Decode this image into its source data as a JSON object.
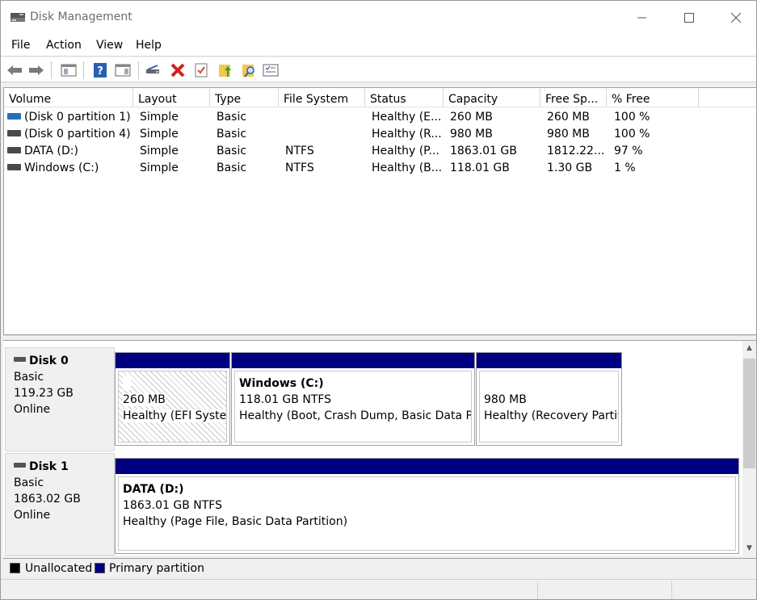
{
  "window": {
    "title": "Disk Management",
    "minimize_icon": "minimize-icon",
    "maximize_icon": "maximize-icon",
    "close_icon": "close-icon"
  },
  "menu": [
    "File",
    "Action",
    "View",
    "Help"
  ],
  "toolbar": [
    "back-arrow-icon",
    "forward-arrow-icon",
    "console-tree-icon",
    "help-icon",
    "action-pane-icon",
    "connect-drive-icon",
    "delete-icon",
    "check-icon",
    "folder-up-icon",
    "folder-search-icon",
    "properties-icon"
  ],
  "volume_list": {
    "columns": [
      "Volume",
      "Layout",
      "Type",
      "File System",
      "Status",
      "Capacity",
      "Free Sp...",
      "% Free"
    ],
    "rows": [
      {
        "volume": "(Disk 0 partition 1)",
        "layout": "Simple",
        "type": "Basic",
        "fs": "",
        "status": "Healthy (E...",
        "capacity": "260 MB",
        "free": "260 MB",
        "pct": "100 %",
        "icon_color": "#2a6ebb"
      },
      {
        "volume": "(Disk 0 partition 4)",
        "layout": "Simple",
        "type": "Basic",
        "fs": "",
        "status": "Healthy (R...",
        "capacity": "980 MB",
        "free": "980 MB",
        "pct": "100 %",
        "icon_color": "#4a4a4a"
      },
      {
        "volume": "DATA (D:)",
        "layout": "Simple",
        "type": "Basic",
        "fs": "NTFS",
        "status": "Healthy (P...",
        "capacity": "1863.01 GB",
        "free": "1812.22...",
        "pct": "97 %",
        "icon_color": "#4a4a4a"
      },
      {
        "volume": "Windows (C:)",
        "layout": "Simple",
        "type": "Basic",
        "fs": "NTFS",
        "status": "Healthy (B...",
        "capacity": "118.01 GB",
        "free": "1.30 GB",
        "pct": "1 %",
        "icon_color": "#4a4a4a"
      }
    ]
  },
  "disks": [
    {
      "name": "Disk 0",
      "type": "Basic",
      "size": "119.23 GB",
      "state": "Online",
      "partitions": [
        {
          "title": "",
          "size": "260 MB",
          "status": "Healthy (EFI Syster"
        },
        {
          "title": "Windows  (C:)",
          "size": "118.01 GB NTFS",
          "status": "Healthy (Boot, Crash Dump, Basic Data Par"
        },
        {
          "title": "",
          "size": "980 MB",
          "status": "Healthy (Recovery Partit"
        }
      ]
    },
    {
      "name": "Disk 1",
      "type": "Basic",
      "size": "1863.02 GB",
      "state": "Online",
      "partitions": [
        {
          "title": "DATA  (D:)",
          "size": "1863.01 GB NTFS",
          "status": "Healthy (Page File, Basic Data Partition)"
        }
      ]
    }
  ],
  "legend": {
    "unallocated": "Unallocated",
    "primary": "Primary partition",
    "unallocated_color": "#000000",
    "primary_color": "#000080"
  },
  "colors": {
    "primary_partition": "#000080",
    "accent_blue": "#2a6ebb"
  }
}
